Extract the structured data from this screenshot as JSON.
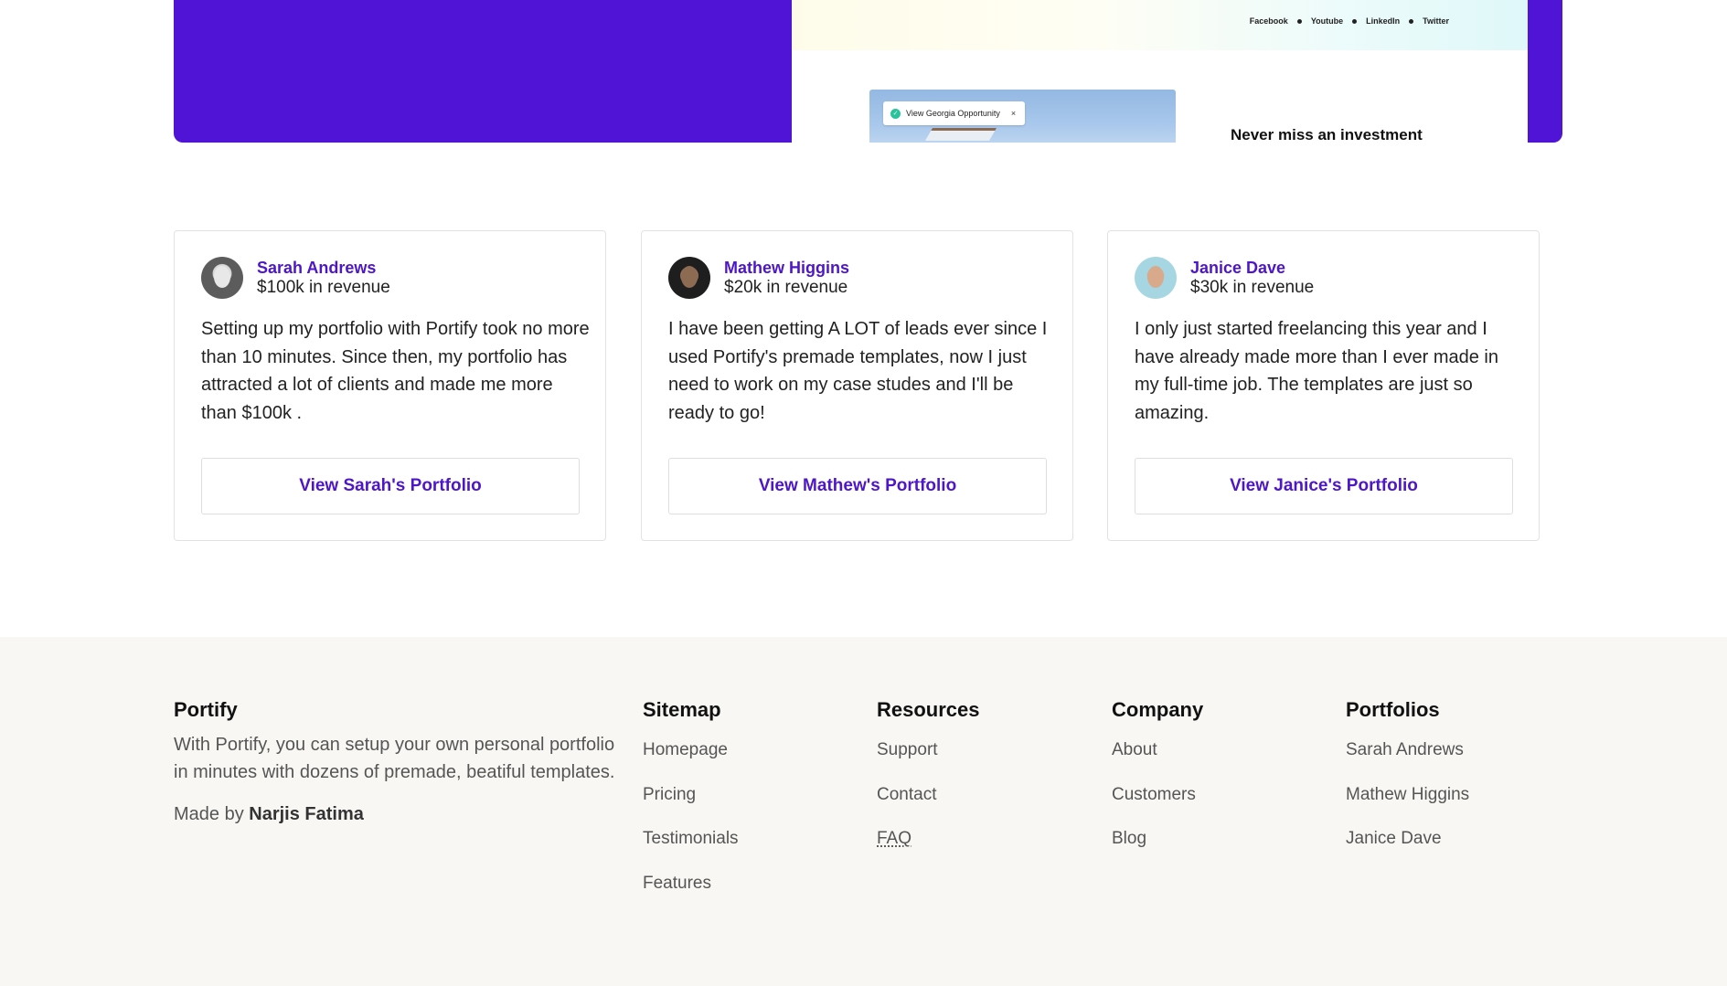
{
  "hero": {
    "social_links": [
      "Facebook",
      "Youtube",
      "LinkedIn",
      "Twitter"
    ],
    "opportunity_chip": "View Georgia Opportunity",
    "chip_close": "×",
    "headline_partial": "Never miss an investment",
    "accent_color": "#4f14d6"
  },
  "testimonials": [
    {
      "name": "Sarah Andrews",
      "revenue": "$100k in revenue",
      "quote": "Setting up my portfolio with Portify took no more than 10 minutes. Since then, my portfolio has attracted a lot of clients and made me more than $100k .",
      "button": "View Sarah's Portfolio"
    },
    {
      "name": "Mathew Higgins",
      "revenue": "$20k in revenue",
      "quote": "I have been getting A LOT of leads ever since I used Portify's premade templates, now I just need to work on my case studes and I'll be ready to go!",
      "button": "View Mathew's Portfolio"
    },
    {
      "name": "Janice Dave",
      "revenue": "$30k in revenue",
      "quote": "I only just started freelancing this year and I have already made more than I ever made in my full-time job. The templates are just so amazing.",
      "button": "View Janice's Portfolio"
    }
  ],
  "footer": {
    "brand": "Portify",
    "description": "With Portify, you can setup your own personal portfolio in minutes with dozens of premade, beatiful templates.",
    "made_by_prefix": "Made by ",
    "made_by_name": "Narjis Fatima",
    "columns": [
      {
        "title": "Sitemap",
        "links": [
          "Homepage",
          "Pricing",
          "Testimonials",
          "Features"
        ]
      },
      {
        "title": "Resources",
        "links": [
          "Support",
          "Contact",
          "FAQ"
        ]
      },
      {
        "title": "Company",
        "links": [
          "About",
          "Customers",
          "Blog"
        ]
      },
      {
        "title": "Portfolios",
        "links": [
          "Sarah Andrews",
          "Mathew Higgins",
          "Janice Dave"
        ]
      }
    ],
    "background_color": "#f9f7f3"
  },
  "colors": {
    "brand_purple": "#4d16c8",
    "check_green": "#27c39a"
  }
}
